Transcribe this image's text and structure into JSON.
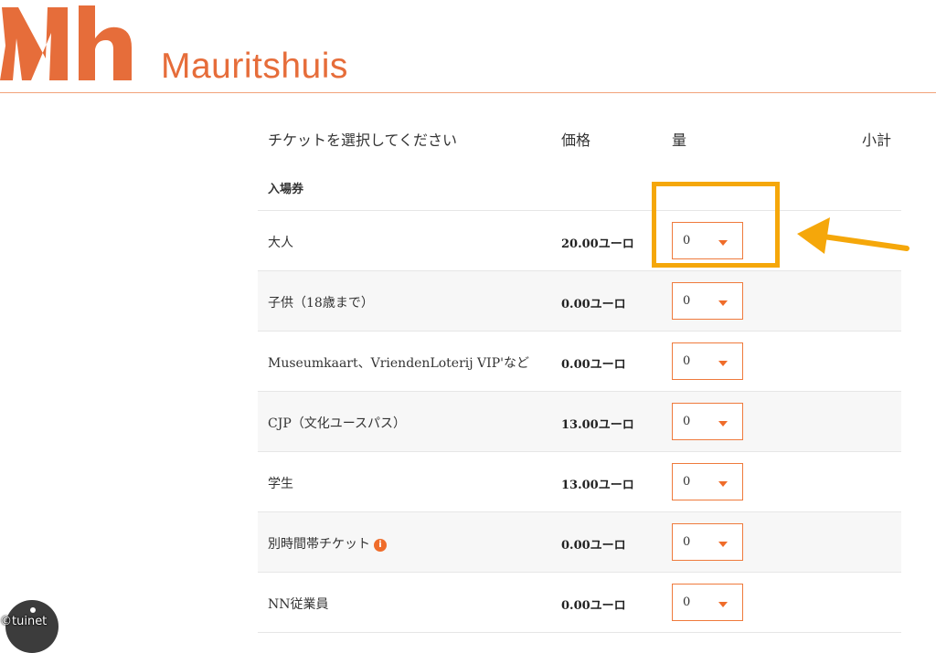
{
  "brand": {
    "name": "Mauritshuis",
    "logo_mark": "Mh",
    "accent_color": "#e66d3a"
  },
  "table": {
    "headers": {
      "name": "チケットを選択してください",
      "price": "価格",
      "quantity": "量",
      "subtotal": "小計"
    },
    "section_title": "入場券",
    "rows": [
      {
        "name": "大人",
        "price": "20.00ユーロ",
        "quantity": "0"
      },
      {
        "name": "子供（18歳まで）",
        "price": "0.00ユーロ",
        "quantity": "0"
      },
      {
        "name": "Museumkaart、VriendenLoterij VIP'など",
        "price": "0.00ユーロ",
        "quantity": "0"
      },
      {
        "name": "CJP（文化ユースパス）",
        "price": "13.00ユーロ",
        "quantity": "0"
      },
      {
        "name": "学生",
        "price": "13.00ユーロ",
        "quantity": "0"
      },
      {
        "name": "別時間帯チケット",
        "price": "0.00ユーロ",
        "quantity": "0",
        "icon": "info-icon"
      },
      {
        "name": "NN従業員",
        "price": "0.00ユーロ",
        "quantity": "0"
      }
    ]
  },
  "annotation": {
    "highlight_color": "#f5a70a"
  },
  "chat": {
    "icon": "chat-icon"
  },
  "watermark": {
    "text": "©tuinet"
  }
}
